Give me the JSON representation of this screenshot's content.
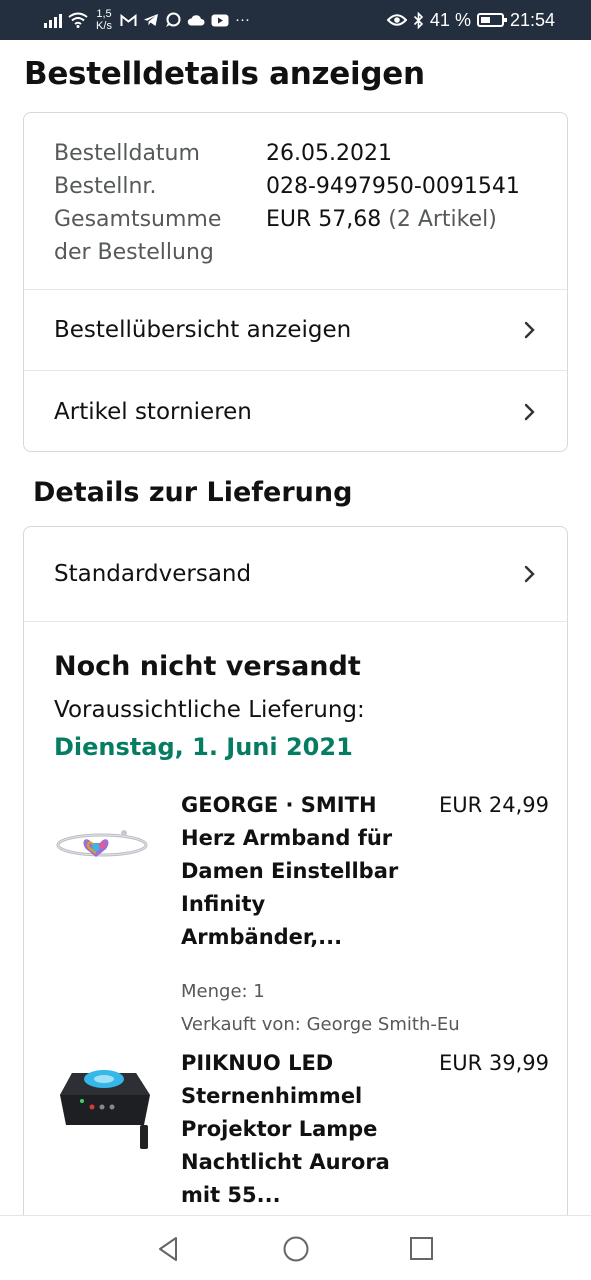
{
  "status_bar": {
    "speed_value": "1,5",
    "speed_unit": "K/s",
    "battery_percent": "41 %",
    "time": "21:54",
    "icons": [
      "signal-icon",
      "wifi-icon",
      "gmail-icon",
      "telegram-icon",
      "whatsapp-icon",
      "cloud-icon",
      "youtube-icon",
      "more-icon",
      "eye-icon",
      "bluetooth-icon",
      "battery-icon"
    ]
  },
  "page": {
    "title": "Bestelldetails anzeigen"
  },
  "order_info": {
    "date_label": "Bestelldatum",
    "date_value": "26.05.2021",
    "number_label": "Bestellnr.",
    "number_value": "028-9497950-0091541",
    "total_label_line1": "Gesamtsumme",
    "total_label_line2": "der Bestellung",
    "total_value": "EUR 57,68",
    "total_items": "(2 Artikel)"
  },
  "links": {
    "overview": "Bestellübersicht anzeigen",
    "cancel": "Artikel stornieren"
  },
  "delivery": {
    "section_title": "Details zur Lieferung",
    "shipping_method": "Standardversand",
    "status": "Noch nicht versandt",
    "eta_label": "Voraussichtliche Lieferung:",
    "eta_date": "Dienstag, 1. Juni 2021",
    "accent_color": "#067d62"
  },
  "items": [
    {
      "title_lines": [
        "GEORGE · SMITH",
        "Herz Armband für",
        "Damen Einstellbar",
        "Infinity",
        "Armbänder,..."
      ],
      "price": "EUR 24,99",
      "quantity": "Menge: 1",
      "seller": "Verkauft von: George Smith-Eu"
    },
    {
      "title_lines": [
        "PIIKNUO LED",
        "Sternenhimmel",
        "Projektor Lampe",
        "Nachtlicht Aurora",
        "mit 55..."
      ],
      "price": "EUR 39,99"
    }
  ],
  "nav": {
    "icons": [
      "back-icon",
      "home-icon",
      "recents-icon"
    ]
  }
}
